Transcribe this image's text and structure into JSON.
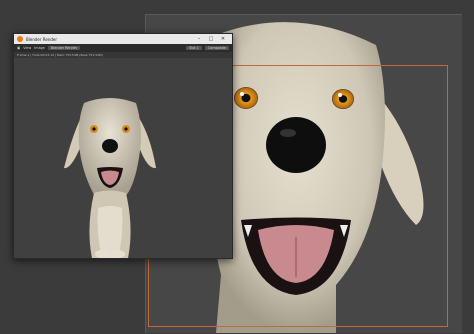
{
  "render_window": {
    "title": "Blender Render",
    "toolbar": {
      "view": "View",
      "image": "Image",
      "slot": "Slot 1",
      "layer": "Blender Render",
      "composite": "Composite"
    },
    "info": "Frame:1 | Time:00:03.14 | Mem:733.54M (Peak 751.54M)"
  },
  "viewport": {
    "toolbar_right": [
      "Slot 1",
      "View Layer"
    ]
  },
  "colors": {
    "camera_frame": "#c06a3a",
    "background": "#3b3b3b",
    "panel": "#424242"
  }
}
